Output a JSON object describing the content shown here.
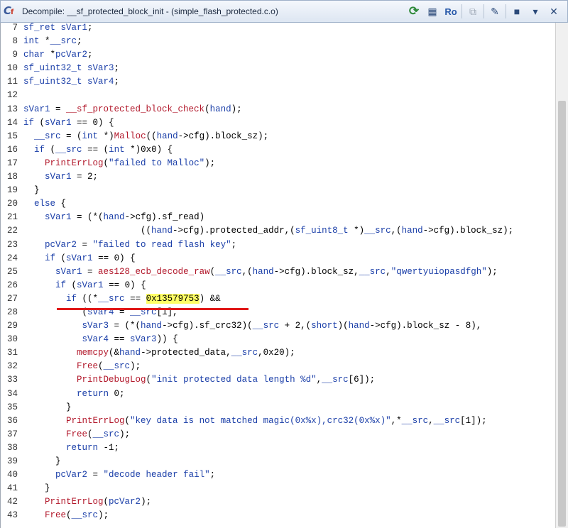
{
  "window": {
    "title": "Decompile: __sf_protected_block_init - (simple_flash_protected.c.o)"
  },
  "toolbar": {
    "ro_label": "Ro"
  },
  "code_lines": [
    {
      "n": "7",
      "tokens": [
        [
          "t",
          "sf_ret"
        ],
        [
          "c",
          " "
        ],
        [
          "v",
          "sVar1"
        ],
        [
          "c",
          ";"
        ]
      ]
    },
    {
      "n": "8",
      "tokens": [
        [
          "t",
          "int"
        ],
        [
          "c",
          " *"
        ],
        [
          "v",
          "__src"
        ],
        [
          "c",
          ";"
        ]
      ]
    },
    {
      "n": "9",
      "tokens": [
        [
          "t",
          "char"
        ],
        [
          "c",
          " *"
        ],
        [
          "v",
          "pcVar2"
        ],
        [
          "c",
          ";"
        ]
      ]
    },
    {
      "n": "10",
      "tokens": [
        [
          "t",
          "sf_uint32_t"
        ],
        [
          "c",
          " "
        ],
        [
          "v",
          "sVar3"
        ],
        [
          "c",
          ";"
        ]
      ]
    },
    {
      "n": "11",
      "tokens": [
        [
          "t",
          "sf_uint32_t"
        ],
        [
          "c",
          " "
        ],
        [
          "v",
          "sVar4"
        ],
        [
          "c",
          ";"
        ]
      ]
    },
    {
      "n": "12",
      "tokens": []
    },
    {
      "n": "13",
      "tokens": [
        [
          "v",
          "sVar1"
        ],
        [
          "c",
          " = "
        ],
        [
          "fn",
          "__sf_protected_block_check"
        ],
        [
          "c",
          "("
        ],
        [
          "v",
          "hand"
        ],
        [
          "c",
          ");"
        ]
      ]
    },
    {
      "n": "14",
      "tokens": [
        [
          "t",
          "if"
        ],
        [
          "c",
          " ("
        ],
        [
          "v",
          "sVar1"
        ],
        [
          "c",
          " == 0) {"
        ]
      ]
    },
    {
      "n": "15",
      "tokens": [
        [
          "c",
          "  "
        ],
        [
          "v",
          "__src"
        ],
        [
          "c",
          " = ("
        ],
        [
          "t",
          "int"
        ],
        [
          "c",
          " *)"
        ],
        [
          "fn",
          "Malloc"
        ],
        [
          "c",
          "(("
        ],
        [
          "v",
          "hand"
        ],
        [
          "c",
          "->cfg).block_sz);"
        ]
      ]
    },
    {
      "n": "16",
      "tokens": [
        [
          "c",
          "  "
        ],
        [
          "t",
          "if"
        ],
        [
          "c",
          " ("
        ],
        [
          "v",
          "__src"
        ],
        [
          "c",
          " == ("
        ],
        [
          "t",
          "int"
        ],
        [
          "c",
          " *)0x0) {"
        ]
      ]
    },
    {
      "n": "17",
      "tokens": [
        [
          "c",
          "    "
        ],
        [
          "fn",
          "PrintErrLog"
        ],
        [
          "c",
          "("
        ],
        [
          "s",
          "\"failed to Malloc\""
        ],
        [
          "c",
          ");"
        ]
      ]
    },
    {
      "n": "18",
      "tokens": [
        [
          "c",
          "    "
        ],
        [
          "v",
          "sVar1"
        ],
        [
          "c",
          " = 2;"
        ]
      ]
    },
    {
      "n": "19",
      "tokens": [
        [
          "c",
          "  }"
        ]
      ]
    },
    {
      "n": "20",
      "tokens": [
        [
          "c",
          "  "
        ],
        [
          "t",
          "else"
        ],
        [
          "c",
          " {"
        ]
      ]
    },
    {
      "n": "21",
      "tokens": [
        [
          "c",
          "    "
        ],
        [
          "v",
          "sVar1"
        ],
        [
          "c",
          " = (*("
        ],
        [
          "v",
          "hand"
        ],
        [
          "c",
          "->cfg).sf_read)"
        ]
      ]
    },
    {
      "n": "22",
      "tokens": [
        [
          "c",
          "                      (("
        ],
        [
          "v",
          "hand"
        ],
        [
          "c",
          "->cfg).protected_addr,("
        ],
        [
          "t",
          "sf_uint8_t"
        ],
        [
          "c",
          " *)"
        ],
        [
          "v",
          "__src"
        ],
        [
          "c",
          ",("
        ],
        [
          "v",
          "hand"
        ],
        [
          "c",
          "->cfg).block_sz);"
        ]
      ]
    },
    {
      "n": "23",
      "tokens": [
        [
          "c",
          "    "
        ],
        [
          "v",
          "pcVar2"
        ],
        [
          "c",
          " = "
        ],
        [
          "s",
          "\"failed to read flash key\""
        ],
        [
          "c",
          ";"
        ]
      ]
    },
    {
      "n": "24",
      "tokens": [
        [
          "c",
          "    "
        ],
        [
          "t",
          "if"
        ],
        [
          "c",
          " ("
        ],
        [
          "v",
          "sVar1"
        ],
        [
          "c",
          " == 0) {"
        ]
      ]
    },
    {
      "n": "25",
      "tokens": [
        [
          "c",
          "      "
        ],
        [
          "v",
          "sVar1"
        ],
        [
          "c",
          " = "
        ],
        [
          "fn",
          "aes128_ecb_decode_raw"
        ],
        [
          "c",
          "("
        ],
        [
          "v",
          "__src"
        ],
        [
          "c",
          ",("
        ],
        [
          "v",
          "hand"
        ],
        [
          "c",
          "->cfg).block_sz,"
        ],
        [
          "v",
          "__src"
        ],
        [
          "c",
          ","
        ],
        [
          "s",
          "\"qwertyuiopasdfgh\""
        ],
        [
          "c",
          ");"
        ]
      ]
    },
    {
      "n": "26",
      "tokens": [
        [
          "c",
          "      "
        ],
        [
          "t",
          "if"
        ],
        [
          "c",
          " ("
        ],
        [
          "v",
          "sVar1"
        ],
        [
          "c",
          " == 0) {"
        ]
      ]
    },
    {
      "n": "27",
      "tokens": [
        [
          "c",
          "        "
        ],
        [
          "t",
          "if"
        ],
        [
          "c",
          " ((*"
        ],
        [
          "v",
          "__src"
        ],
        [
          "c",
          " == "
        ],
        [
          "hl",
          "0x13579753"
        ],
        [
          "c",
          ") &&"
        ]
      ]
    },
    {
      "n": "28",
      "tokens": [
        [
          "c",
          "           ("
        ],
        [
          "v",
          "sVar4"
        ],
        [
          "c",
          " = "
        ],
        [
          "v",
          "__src"
        ],
        [
          "c",
          "[1],"
        ]
      ]
    },
    {
      "n": "29",
      "tokens": [
        [
          "c",
          "           "
        ],
        [
          "v",
          "sVar3"
        ],
        [
          "c",
          " = (*("
        ],
        [
          "v",
          "hand"
        ],
        [
          "c",
          "->cfg).sf_crc32)("
        ],
        [
          "v",
          "__src"
        ],
        [
          "c",
          " + 2,("
        ],
        [
          "t",
          "short"
        ],
        [
          "c",
          ")("
        ],
        [
          "v",
          "hand"
        ],
        [
          "c",
          "->cfg).block_sz - 8),"
        ]
      ]
    },
    {
      "n": "30",
      "tokens": [
        [
          "c",
          "           "
        ],
        [
          "v",
          "sVar4"
        ],
        [
          "c",
          " == "
        ],
        [
          "v",
          "sVar3"
        ],
        [
          "c",
          ")) {"
        ]
      ]
    },
    {
      "n": "31",
      "tokens": [
        [
          "c",
          "          "
        ],
        [
          "fn",
          "memcpy"
        ],
        [
          "c",
          "(&"
        ],
        [
          "v",
          "hand"
        ],
        [
          "c",
          "->protected_data,"
        ],
        [
          "v",
          "__src"
        ],
        [
          "c",
          ",0x20);"
        ]
      ]
    },
    {
      "n": "32",
      "tokens": [
        [
          "c",
          "          "
        ],
        [
          "fn",
          "Free"
        ],
        [
          "c",
          "("
        ],
        [
          "v",
          "__src"
        ],
        [
          "c",
          ");"
        ]
      ]
    },
    {
      "n": "33",
      "tokens": [
        [
          "c",
          "          "
        ],
        [
          "fn",
          "PrintDebugLog"
        ],
        [
          "c",
          "("
        ],
        [
          "s",
          "\"init protected data length %d\""
        ],
        [
          "c",
          ","
        ],
        [
          "v",
          "__src"
        ],
        [
          "c",
          "[6]);"
        ]
      ]
    },
    {
      "n": "34",
      "tokens": [
        [
          "c",
          "          "
        ],
        [
          "t",
          "return"
        ],
        [
          "c",
          " 0;"
        ]
      ]
    },
    {
      "n": "35",
      "tokens": [
        [
          "c",
          "        }"
        ]
      ]
    },
    {
      "n": "36",
      "tokens": [
        [
          "c",
          "        "
        ],
        [
          "fn",
          "PrintErrLog"
        ],
        [
          "c",
          "("
        ],
        [
          "s",
          "\"key data is not matched magic(0x%x),crc32(0x%x)\""
        ],
        [
          "c",
          ",*"
        ],
        [
          "v",
          "__src"
        ],
        [
          "c",
          ","
        ],
        [
          "v",
          "__src"
        ],
        [
          "c",
          "[1]);"
        ]
      ]
    },
    {
      "n": "37",
      "tokens": [
        [
          "c",
          "        "
        ],
        [
          "fn",
          "Free"
        ],
        [
          "c",
          "("
        ],
        [
          "v",
          "__src"
        ],
        [
          "c",
          ");"
        ]
      ]
    },
    {
      "n": "38",
      "tokens": [
        [
          "c",
          "        "
        ],
        [
          "t",
          "return"
        ],
        [
          "c",
          " -1;"
        ]
      ]
    },
    {
      "n": "39",
      "tokens": [
        [
          "c",
          "      }"
        ]
      ]
    },
    {
      "n": "40",
      "tokens": [
        [
          "c",
          "      "
        ],
        [
          "v",
          "pcVar2"
        ],
        [
          "c",
          " = "
        ],
        [
          "s",
          "\"decode header fail\""
        ],
        [
          "c",
          ";"
        ]
      ]
    },
    {
      "n": "41",
      "tokens": [
        [
          "c",
          "    }"
        ]
      ]
    },
    {
      "n": "42",
      "tokens": [
        [
          "c",
          "    "
        ],
        [
          "fn",
          "PrintErrLog"
        ],
        [
          "c",
          "("
        ],
        [
          "v",
          "pcVar2"
        ],
        [
          "c",
          ");"
        ]
      ]
    },
    {
      "n": "43",
      "tokens": [
        [
          "c",
          "    "
        ],
        [
          "fn",
          "Free"
        ],
        [
          "c",
          "("
        ],
        [
          "v",
          "__src"
        ],
        [
          "c",
          ");"
        ]
      ]
    }
  ]
}
